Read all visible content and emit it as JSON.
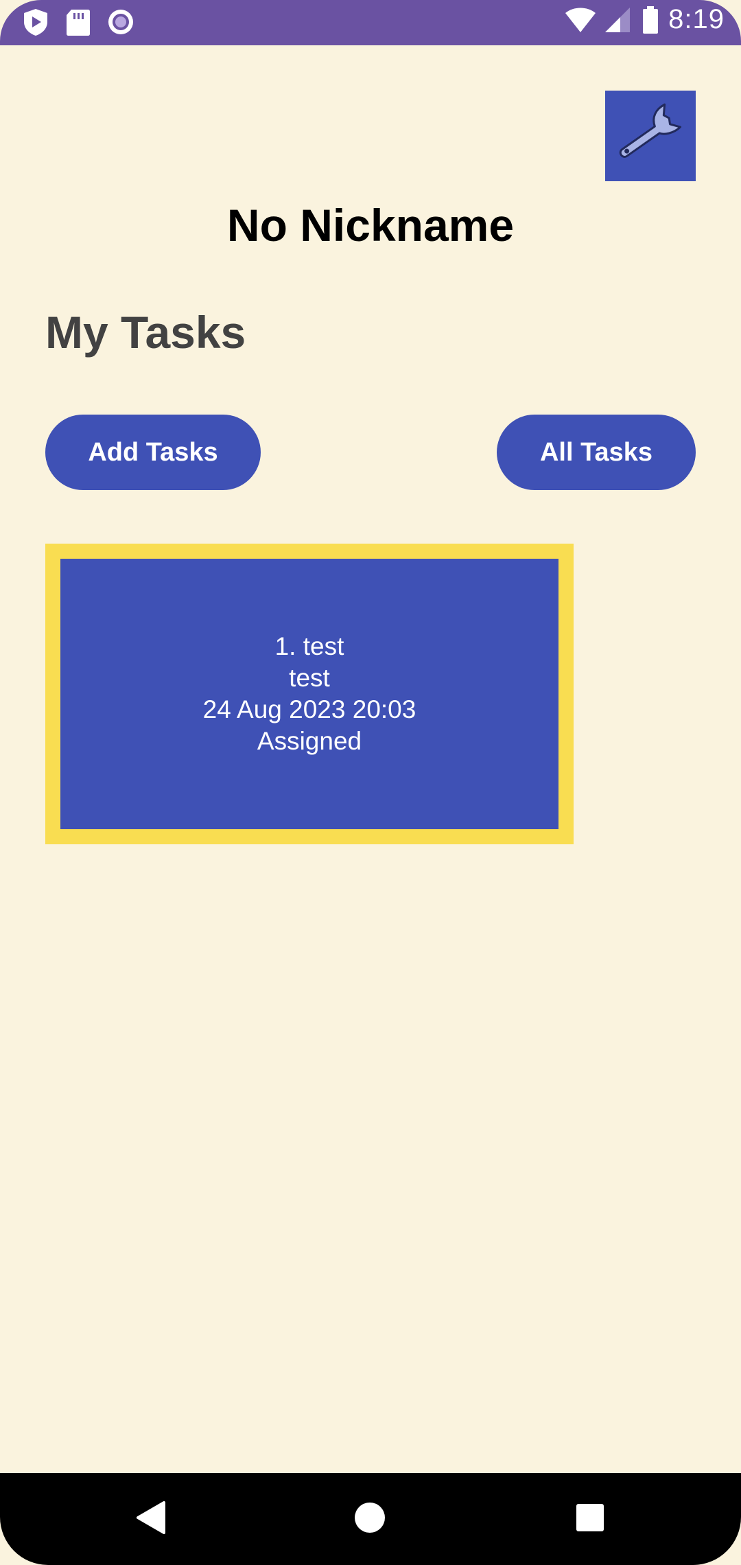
{
  "status_bar": {
    "time": "8:19",
    "left_icons": [
      "shield-play-icon",
      "sd-card-icon",
      "record-circle-icon"
    ],
    "right_icons": [
      "wifi-icon",
      "cell-signal-icon",
      "battery-icon"
    ],
    "background_color": "#6a52a2"
  },
  "header": {
    "settings_icon": "wrench-icon",
    "nickname": "No Nickname"
  },
  "main": {
    "section_title": "My Tasks",
    "add_tasks_label": "Add Tasks",
    "all_tasks_label": "All Tasks",
    "tasks": [
      {
        "title": "1. test",
        "description": "test",
        "datetime": "24 Aug 2023 20:03",
        "status": "Assigned"
      }
    ]
  },
  "nav_bar": {
    "buttons": [
      "back-icon",
      "home-icon",
      "recents-icon"
    ]
  },
  "colors": {
    "background": "#faf3de",
    "primary": "#3f51b5",
    "card_border": "#f9dd51",
    "section_title": "#424242"
  }
}
